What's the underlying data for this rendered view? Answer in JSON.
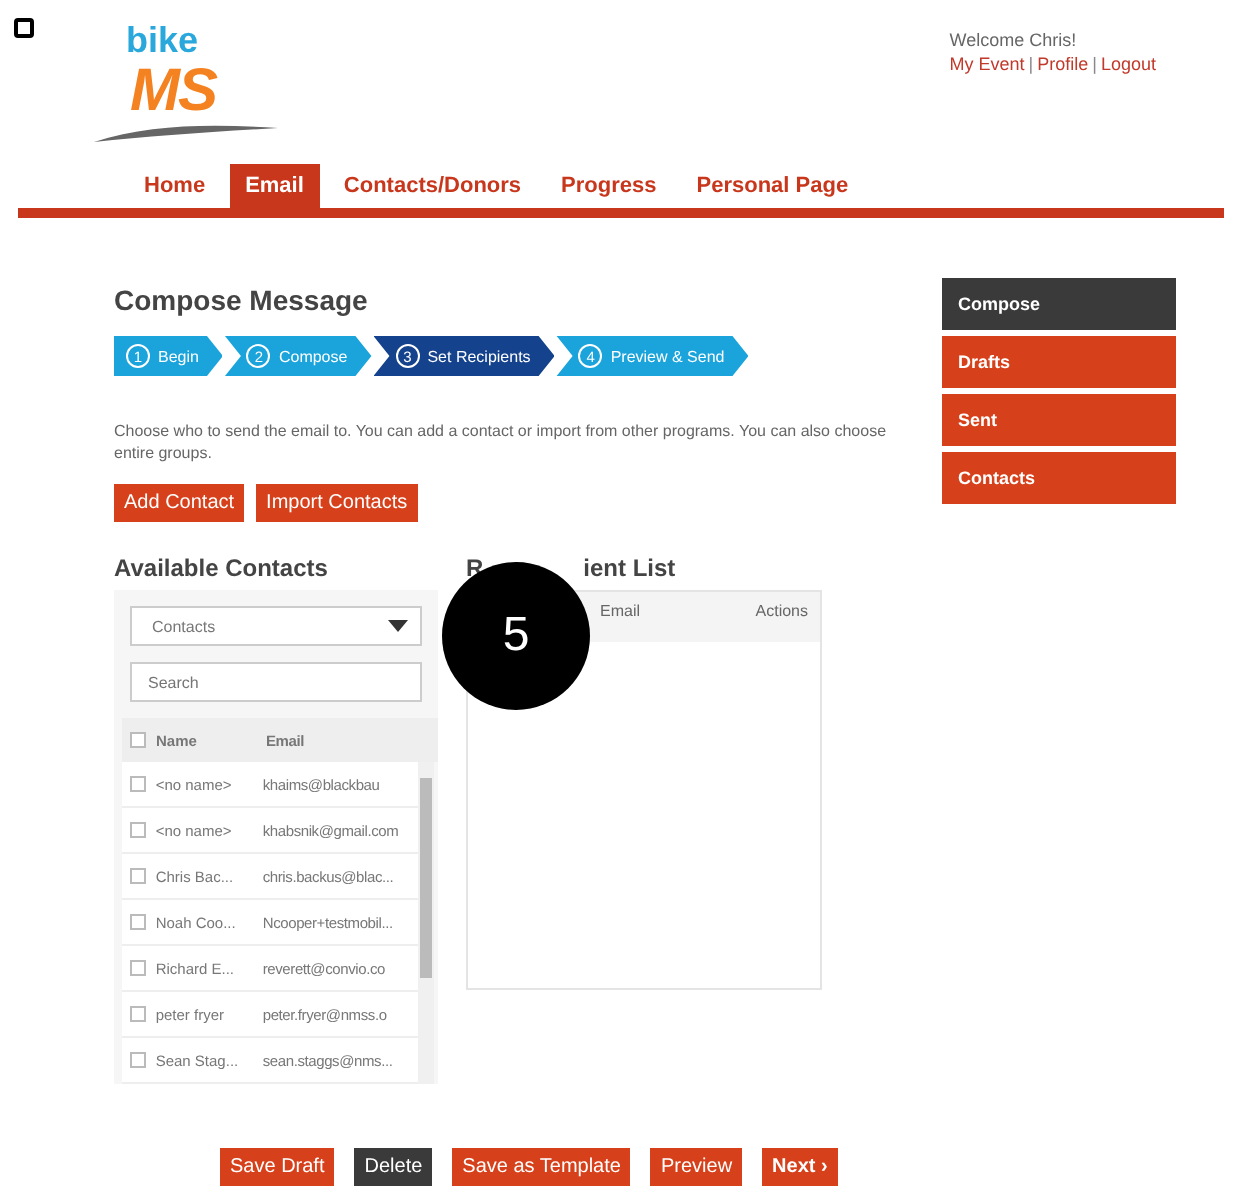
{
  "header": {
    "logo_top": "bike",
    "logo_bottom": "MS",
    "welcome": "Welcome Chris!",
    "links": [
      "My Event",
      "Profile",
      "Logout"
    ],
    "link_separator": "|"
  },
  "nav": [
    {
      "label": "Home",
      "selected": false
    },
    {
      "label": "Email",
      "selected": true
    },
    {
      "label": "Contacts/Donors",
      "selected": false
    },
    {
      "label": "Progress",
      "selected": false
    },
    {
      "label": "Personal Page",
      "selected": false
    }
  ],
  "title": "Compose Message",
  "steps": [
    {
      "number": "1",
      "label": "Begin",
      "selected": false
    },
    {
      "number": "2",
      "label": "Compose",
      "selected": false
    },
    {
      "number": "3",
      "label": "Set Recipients",
      "selected": true
    },
    {
      "number": "4",
      "label": "Preview & Send",
      "selected": false
    }
  ],
  "description": "Choose who to send the email to. You can add a contact or import from other programs. You can also choose entire groups.",
  "actions": [
    "Add Contact",
    "Import Contacts"
  ],
  "sidebar": [
    {
      "label": "Compose",
      "selected": true
    },
    {
      "label": "Drafts",
      "selected": false
    },
    {
      "label": "Sent",
      "selected": false
    },
    {
      "label": "Contacts",
      "selected": false
    }
  ],
  "available": {
    "title": "Available Contacts",
    "dropdown": "Contacts",
    "search": {
      "placeholder": "Search"
    },
    "columns": [
      "Name",
      "Email"
    ],
    "all_checked": false,
    "rows": [
      {
        "name": "<no name>",
        "email": "khaims@blackbau",
        "checked": false
      },
      {
        "name": "<no name>",
        "email": "khabsnik@gmail.com",
        "checked": false
      },
      {
        "name": "Chris Bac...",
        "email": "chris.backus@blac...",
        "checked": false
      },
      {
        "name": "Noah Coo...",
        "email": "Ncooper+testmobil...",
        "checked": false
      },
      {
        "name": "Richard E...",
        "email": "reverett@convio.co",
        "checked": false
      },
      {
        "name": "peter fryer",
        "email": "peter.fryer@nmss.o",
        "checked": false
      },
      {
        "name": "Sean Stag...",
        "email": "sean.staggs@nms...",
        "checked": false
      }
    ]
  },
  "recipients": {
    "title_parts": [
      "R",
      "ient List"
    ],
    "columns": [
      "Email",
      "Actions"
    ]
  },
  "callout": "5",
  "footer": [
    {
      "label": "Save Draft",
      "kind": "primary"
    },
    {
      "label": "Delete",
      "kind": "dark"
    },
    {
      "label": "Save as Template",
      "kind": "primary"
    },
    {
      "label": "Preview",
      "kind": "primary"
    },
    {
      "label": "Next ›",
      "kind": "strong"
    }
  ]
}
